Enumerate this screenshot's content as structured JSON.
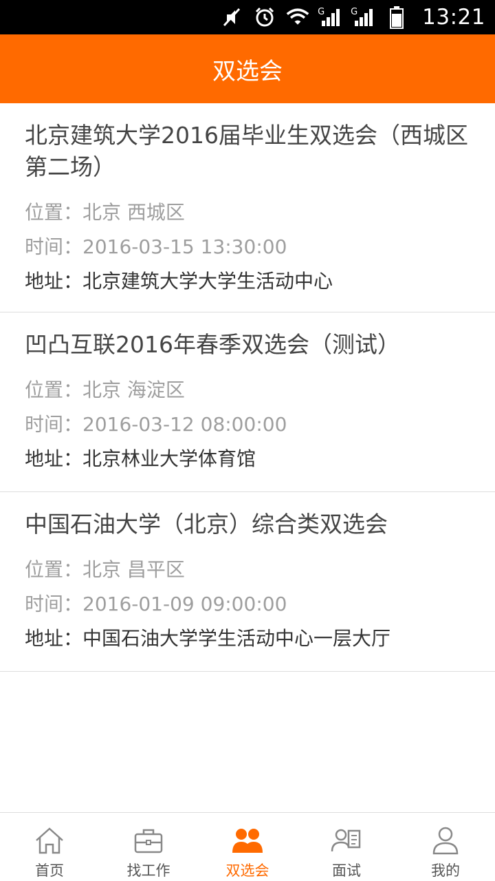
{
  "status_bar": {
    "time": "13:21",
    "signal_1_label": "G",
    "signal_2_label": "G",
    "icons": [
      "mute-icon",
      "alarm-icon",
      "wifi-icon",
      "signal-icon",
      "signal-icon",
      "battery-icon"
    ]
  },
  "header": {
    "title": "双选会"
  },
  "events": [
    {
      "title": "北京建筑大学2016届毕业生双选会（西城区第二场）",
      "location": "位置：北京 西城区",
      "time": "时间：2016-03-15 13:30:00",
      "address": "地址：北京建筑大学大学生活动中心"
    },
    {
      "title": "凹凸互联2016年春季双选会（测试）",
      "location": "位置：北京 海淀区",
      "time": "时间：2016-03-12 08:00:00",
      "address": "地址：北京林业大学体育馆"
    },
    {
      "title": "中国石油大学（北京）综合类双选会",
      "location": "位置：北京 昌平区",
      "time": "时间：2016-01-09 09:00:00",
      "address": "地址：中国石油大学学生活动中心一层大厅"
    }
  ],
  "nav": {
    "items": [
      {
        "label": "首页",
        "icon": "home-icon"
      },
      {
        "label": "找工作",
        "icon": "briefcase-icon"
      },
      {
        "label": "双选会",
        "icon": "people-icon",
        "active": true
      },
      {
        "label": "面试",
        "icon": "interview-icon"
      },
      {
        "label": "我的",
        "icon": "user-icon"
      }
    ]
  },
  "colors": {
    "accent": "#ff6a00",
    "muted_text": "#9e9e9e",
    "dark_text": "#333333"
  }
}
